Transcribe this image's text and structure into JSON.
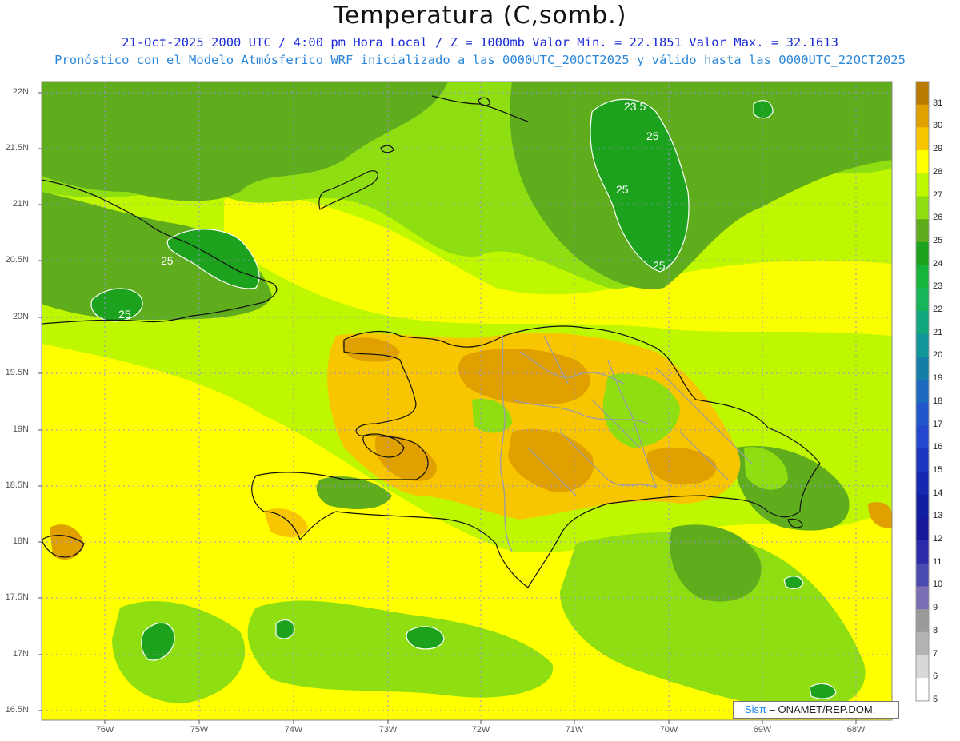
{
  "title": "Temperatura (C,somb.)",
  "subtitle_line1": "21-Oct-2025  2000 UTC / 4:00 pm Hora Local / Z = 1000mb   Valor Min. = 22.1851  Valor Max. = 32.1613",
  "subtitle_line2": "Pronóstico con el Modelo Atmósferico WRF inicializado a las 0000UTC_20OCT2025 y válido hasta las  0000UTC_22OCT2025",
  "lat_labels": [
    "22N",
    "21.5N",
    "21N",
    "20.5N",
    "20N",
    "19.5N",
    "19N",
    "18.5N",
    "18N",
    "17.5N",
    "17N",
    "16.5N"
  ],
  "lon_labels": [
    "76W",
    "75W",
    "74W",
    "73W",
    "72W",
    "71W",
    "70W",
    "69W",
    "68W"
  ],
  "colorbar": {
    "labels": [
      "31",
      "30",
      "29",
      "28",
      "27",
      "26",
      "25",
      "24",
      "23",
      "22",
      "21",
      "20",
      "19",
      "18",
      "17",
      "16",
      "15",
      "14",
      "13",
      "12",
      "11",
      "10",
      "9",
      "8",
      "7",
      "6",
      "5"
    ],
    "colors": [
      "#b97a00",
      "#e0a000",
      "#f8c600",
      "#ffff00",
      "#bff700",
      "#8ede12",
      "#5fad1d",
      "#1ca21c",
      "#16b43a",
      "#18b45a",
      "#12a77c",
      "#12979a",
      "#147ea8",
      "#1b69c0",
      "#2257cc",
      "#2447cf",
      "#1c36c0",
      "#1528b0",
      "#111ea0",
      "#16189a",
      "#2b2aa8",
      "#4a49b0",
      "#7a6fb4",
      "#9a9a9a",
      "#b3b3b3",
      "#d8d8d8",
      "#ffffff"
    ]
  },
  "contour_labels": [
    "23.5",
    "25",
    "25",
    "25",
    "25",
    "25",
    "25"
  ],
  "credit": {
    "brand": "Sisπ",
    "text": " – ONAMET/REP.DOM."
  }
}
